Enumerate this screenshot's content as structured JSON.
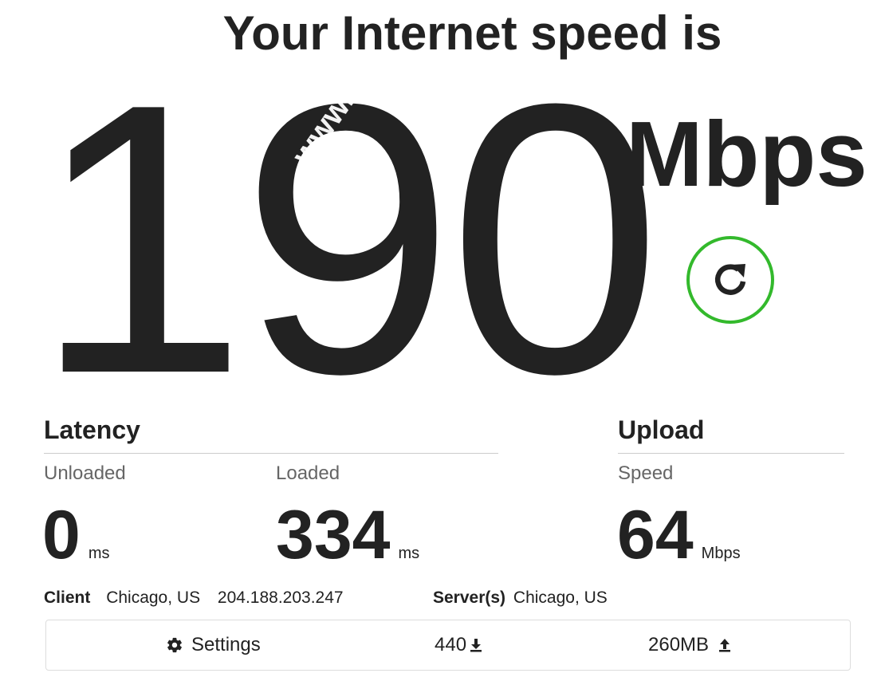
{
  "header": {
    "title": "Your Internet speed is"
  },
  "speed": {
    "value": "190",
    "unit": "Mbps",
    "watermark": "www.ve"
  },
  "refresh": {
    "icon": "refresh-icon",
    "ring_color": "#33b92c"
  },
  "latency": {
    "title": "Latency",
    "unloaded": {
      "label": "Unloaded",
      "value": "0",
      "unit": "ms"
    },
    "loaded": {
      "label": "Loaded",
      "value": "334",
      "unit": "ms"
    }
  },
  "upload": {
    "title": "Upload",
    "speed": {
      "label": "Speed",
      "value": "64",
      "unit": "Mbps"
    }
  },
  "info": {
    "client_label": "Client",
    "client_location": "Chicago, US",
    "client_ip": "204.188.203.247",
    "server_label": "Server(s)",
    "server_location": "Chicago, US"
  },
  "footer": {
    "settings_label": "Settings",
    "settings_icon": "gear-icon",
    "downloaded": "440",
    "download_icon": "download-arrow-icon",
    "uploaded": "260MB",
    "upload_icon": "upload-arrow-icon"
  }
}
